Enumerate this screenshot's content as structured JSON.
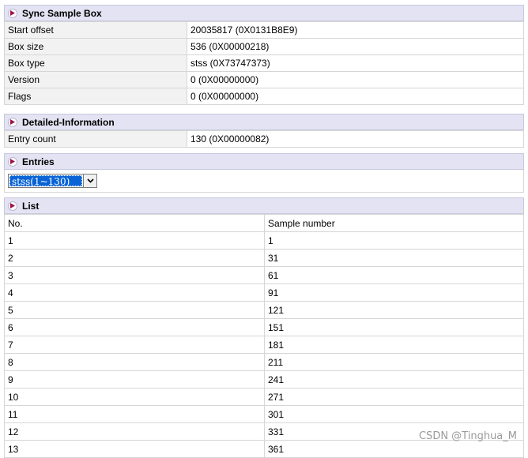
{
  "sync_sample_box": {
    "title": "Sync Sample Box",
    "rows": [
      {
        "label": "Start offset",
        "value": "20035817 (0X0131B8E9)"
      },
      {
        "label": "Box size",
        "value": "536 (0X00000218)"
      },
      {
        "label": "Box type",
        "value": "stss (0X73747373)"
      },
      {
        "label": "Version",
        "value": "0 (0X00000000)"
      },
      {
        "label": "Flags",
        "value": "0 (0X00000000)"
      }
    ]
  },
  "detailed_information": {
    "title": "Detailed-Information",
    "rows": [
      {
        "label": "Entry count",
        "value": "130 (0X00000082)"
      }
    ]
  },
  "entries": {
    "title": "Entries",
    "selected": "stss(1~130)"
  },
  "list": {
    "title": "List",
    "headers": [
      "No.",
      "Sample number"
    ],
    "rows": [
      [
        "1",
        "1"
      ],
      [
        "2",
        "31"
      ],
      [
        "3",
        "61"
      ],
      [
        "4",
        "91"
      ],
      [
        "5",
        "121"
      ],
      [
        "6",
        "151"
      ],
      [
        "7",
        "181"
      ],
      [
        "8",
        "211"
      ],
      [
        "9",
        "241"
      ],
      [
        "10",
        "271"
      ],
      [
        "11",
        "301"
      ],
      [
        "12",
        "331"
      ],
      [
        "13",
        "361"
      ]
    ]
  },
  "watermark": "CSDN @Tinghua_M",
  "icons": {
    "section_arrow": "play-arrow-icon",
    "dropdown": "chevron-down-icon"
  },
  "colors": {
    "header_bg": "#e3e3f3",
    "arrow": "#a0104a",
    "selection": "#0a64d6"
  }
}
